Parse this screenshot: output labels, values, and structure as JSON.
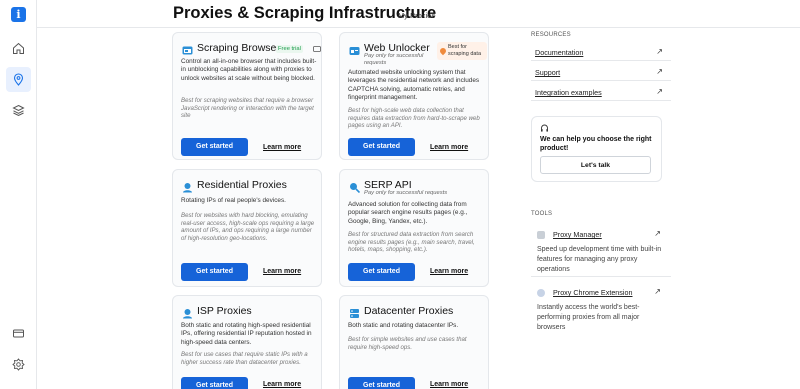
{
  "header": {
    "title": "Proxies & Scraping Infrastructure",
    "breadcrumb": "My Proxies"
  },
  "rail": {
    "logo": "i",
    "icons": [
      "home-icon",
      "location-pin-icon",
      "layers-icon",
      "billing-card-icon",
      "settings-gear-icon"
    ]
  },
  "cards": [
    {
      "title": "Scraping Browser",
      "badge": "Free trial",
      "subtitle": "",
      "description": "Control an all-in-one browser that includes built-in unblocking capabilities along with proxies to unlock websites at scale without being blocked.",
      "use_case": "Best for scraping websites that require a browser JavaScript rendering or interaction with the target site",
      "start_label": "Get started",
      "learn_label": "Learn more"
    },
    {
      "title": "Web Unlocker",
      "badge": "Best for scraping data",
      "subtitle": "Pay only for successful requests",
      "description": "Automated website unlocking system that leverages the residential network and includes CAPTCHA solving, automatic retries, and fingerprint management.",
      "use_case": "Best for high-scale web data collection that requires data extraction from hard-to-scrape web pages using an API.",
      "start_label": "Get started",
      "learn_label": "Learn more"
    },
    {
      "title": "Residential Proxies",
      "badge": "",
      "subtitle": "",
      "description": "Rotating IPs of real people's devices.",
      "use_case": "Best for websites with hard blocking, emulating real-user access, high-scale ops requiring a large amount of IPs, and ops requiring a large number of high-resolution geo-locations.",
      "start_label": "Get started",
      "learn_label": "Learn more"
    },
    {
      "title": "SERP API",
      "badge": "",
      "subtitle": "Pay only for successful requests",
      "description": "Advanced solution for collecting data from popular search engine results pages (e.g., Google, Bing, Yandex, etc.).",
      "use_case": "Best for structured data extraction from search engine results pages (e.g., main search, travel, hotels, maps, shopping, etc.).",
      "start_label": "Get started",
      "learn_label": "Learn more"
    },
    {
      "title": "ISP Proxies",
      "badge": "",
      "subtitle": "",
      "description": "Both static and rotating high-speed residential IPs, offering residential IP reputation hosted in high-speed data centers.",
      "use_case": "Best for use cases that require static IPs with a higher success rate than datacenter proxies.",
      "start_label": "Get started",
      "learn_label": "Learn more"
    },
    {
      "title": "Datacenter Proxies",
      "badge": "",
      "subtitle": "",
      "description": "Both static and rotating datacenter IPs.",
      "use_case": "Best for simple websites and use cases that require high-speed ops.",
      "start_label": "Get started",
      "learn_label": "Learn more"
    }
  ],
  "resources": {
    "heading": "RESOURCES",
    "links": [
      "Documentation",
      "Support",
      "Integration examples"
    ],
    "help_text": "We can help you choose the right product!",
    "help_button": "Let's talk"
  },
  "tools": {
    "heading": "TOOLS",
    "items": [
      {
        "name": "Proxy Manager",
        "description": "Speed up development time with built-in features for managing any proxy operations",
        "icon": "proxy-manager-icon"
      },
      {
        "name": "Proxy Chrome Extension",
        "description": "Instantly access the world's best-performing proxies from all major browsers",
        "icon": "chrome-extension-icon"
      }
    ]
  },
  "colors": {
    "primary_button": "#1663d8",
    "accent_icon": "#2a8fd6",
    "trial_badge": "#1a9b4a",
    "best_badge_bg": "#fff1e8"
  }
}
